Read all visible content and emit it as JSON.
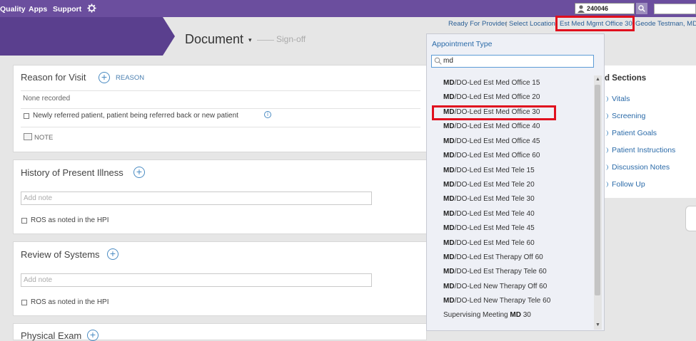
{
  "nav": {
    "quality": "Quality",
    "apps": "Apps",
    "support": "Support"
  },
  "patient": {
    "id": "240046"
  },
  "document": {
    "title": "Document",
    "caret": "▾",
    "signoff": "Sign-off"
  },
  "header_links": {
    "ready": "Ready For Provider",
    "sep": "|",
    "select_location": "Select Location",
    "location": "Est Med Mgmt Office 30",
    "user": "Geode Testman, MD"
  },
  "reason_for_visit": {
    "title": "Reason for Visit",
    "add_label": "REASON",
    "none_recorded": "None recorded",
    "checkbox_label": "Newly referred patient, patient being referred back or new patient",
    "note_label": "NOTE"
  },
  "hpi": {
    "title": "History of Present Illness",
    "note_placeholder": "Add note",
    "checkbox_label": "ROS as noted in the HPI"
  },
  "ros": {
    "title": "Review of Systems",
    "note_placeholder": "Add note",
    "checkbox_label": "ROS as noted in the HPI"
  },
  "physical_exam": {
    "title": "Physical Exam"
  },
  "right_panel": {
    "title": "d Sections",
    "items": [
      "Vitals",
      "Screening",
      "Patient Goals",
      "Patient Instructions",
      "Discussion Notes",
      "Follow Up"
    ]
  },
  "appointment_type": {
    "label": "Appointment Type",
    "search_value": "md",
    "options": [
      {
        "bold": "MD",
        "text": "/DO-Led Est Med Office 15"
      },
      {
        "bold": "MD",
        "text": "/DO-Led Est Med Office 20"
      },
      {
        "bold": "MD",
        "text": "/DO-Led Est Med Office 30"
      },
      {
        "bold": "MD",
        "text": "/DO-Led Est Med Office 40"
      },
      {
        "bold": "MD",
        "text": "/DO-Led Est Med Office 45"
      },
      {
        "bold": "MD",
        "text": "/DO-Led Est Med Office 60"
      },
      {
        "bold": "MD",
        "text": "/DO-Led Est Med Tele 15"
      },
      {
        "bold": "MD",
        "text": "/DO-Led Est Med Tele 20"
      },
      {
        "bold": "MD",
        "text": "/DO-Led Est Med Tele 30"
      },
      {
        "bold": "MD",
        "text": "/DO-Led Est Med Tele 40"
      },
      {
        "bold": "MD",
        "text": "/DO-Led Est Med Tele 45"
      },
      {
        "bold": "MD",
        "text": "/DO-Led Est Med Tele 60"
      },
      {
        "bold": "MD",
        "text": "/DO-Led Est Therapy Off 60"
      },
      {
        "bold": "MD",
        "text": "/DO-Led Est Therapy Tele 60"
      },
      {
        "bold": "MD",
        "text": "/DO-Led New Therapy Off 60"
      },
      {
        "bold": "MD",
        "text": "/DO-Led New Therapy Tele 60"
      }
    ],
    "last_option": {
      "prefix": "Supervising Meeting ",
      "bold": "MD",
      "suffix": " 30"
    }
  },
  "colors": {
    "header_purple": "#6b4e9e",
    "band_purple": "#5a3f8e",
    "link_blue": "#2a6aa8",
    "highlight_red": "#e0101e"
  }
}
